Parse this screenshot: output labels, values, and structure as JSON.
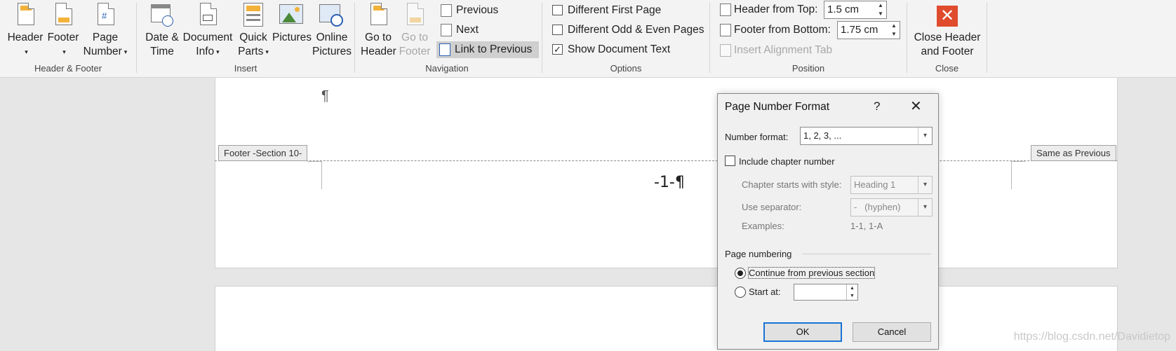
{
  "ribbon": {
    "header_footer_group": {
      "label": "Header & Footer",
      "header": "Header",
      "footer": "Footer",
      "page_number": [
        "Page",
        "Number"
      ]
    },
    "insert_group": {
      "label": "Insert",
      "date_time": [
        "Date &",
        "Time"
      ],
      "document_info": [
        "Document",
        "Info"
      ],
      "quick_parts": [
        "Quick",
        "Parts"
      ],
      "pictures": "Pictures",
      "online_pictures": [
        "Online",
        "Pictures"
      ]
    },
    "navigation_group": {
      "label": "Navigation",
      "go_to_header": [
        "Go to",
        "Header"
      ],
      "go_to_footer": [
        "Go to",
        "Footer"
      ],
      "previous": "Previous",
      "next": "Next",
      "link_to_previous": "Link to Previous"
    },
    "options_group": {
      "label": "Options",
      "different_first_page": "Different First Page",
      "different_odd_even": "Different Odd & Even Pages",
      "show_document_text": "Show Document Text",
      "show_document_text_checked": true
    },
    "position_group": {
      "label": "Position",
      "header_from_top_label": "Header from Top:",
      "header_from_top_value": "1.5 cm",
      "footer_from_bottom_label": "Footer from Bottom:",
      "footer_from_bottom_value": "1.75 cm",
      "insert_alignment_tab": "Insert Alignment Tab"
    },
    "close_group": {
      "label": "Close",
      "close_header_footer": [
        "Close Header",
        "and Footer"
      ],
      "accent": "#e04b2e"
    }
  },
  "document": {
    "pilcrow": "¶",
    "footer_tag": "Footer -Section 10-",
    "same_as_previous": "Same as Previous",
    "page_number_text": "-1-¶"
  },
  "dialog": {
    "title": "Page Number Format",
    "help": "?",
    "close": "✕",
    "number_format_label": "Number format:",
    "number_format_value": "1, 2, 3, ...",
    "include_chapter_label": "Include chapter number",
    "chapter_style_label": "Chapter starts with style:",
    "chapter_style_value": "Heading 1",
    "separator_label": "Use separator:",
    "separator_value": "-   (hyphen)",
    "examples_label": "Examples:",
    "examples_value": "1-1, 1-A",
    "page_numbering_label": "Page numbering",
    "continue_label": "Continue from previous section",
    "start_at_label": "Start at:",
    "start_at_value": "",
    "ok": "OK",
    "cancel": "Cancel"
  },
  "watermark": "https://blog.csdn.net/Davidietop"
}
